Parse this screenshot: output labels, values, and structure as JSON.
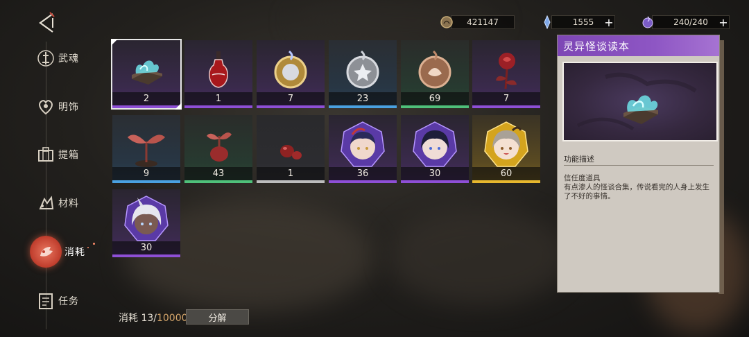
{
  "currency": {
    "coins": "421147",
    "crystals": "1555",
    "stamina": "240/240",
    "plus_label": "+"
  },
  "nav": [
    {
      "label": "武魂",
      "icon": "statue-icon",
      "active": false
    },
    {
      "label": "明饰",
      "icon": "heart-ornament-icon",
      "active": false
    },
    {
      "label": "提箱",
      "icon": "suitcase-icon",
      "active": false
    },
    {
      "label": "材料",
      "icon": "materials-icon",
      "active": false
    },
    {
      "label": "消耗",
      "icon": "consumable-icon",
      "active": true
    },
    {
      "label": "任务",
      "icon": "task-list-icon",
      "active": false
    }
  ],
  "items": [
    {
      "name": "灵异怪谈读本",
      "icon": "ghost-book-icon",
      "count": "2",
      "quality": "purple",
      "quality_color": "#8e4fd6",
      "selected": true
    },
    {
      "name": "red-potion",
      "icon": "red-potion-icon",
      "count": "1",
      "quality": "purple",
      "quality_color": "#8e4fd6"
    },
    {
      "name": "gold-medal",
      "icon": "gold-medal-icon",
      "count": "7",
      "quality": "purple",
      "quality_color": "#8e4fd6"
    },
    {
      "name": "silver-medal",
      "icon": "silver-medal-icon",
      "count": "23",
      "quality": "blue",
      "quality_color": "#4aa1e0"
    },
    {
      "name": "bronze-medal",
      "icon": "bronze-medal-icon",
      "count": "69",
      "quality": "green",
      "quality_color": "#4fc07a"
    },
    {
      "name": "rose",
      "icon": "rose-icon",
      "count": "7",
      "quality": "purple",
      "quality_color": "#8e4fd6"
    },
    {
      "name": "large-sprout",
      "icon": "sprout-large-icon",
      "count": "9",
      "quality": "blue",
      "quality_color": "#4aa1e0"
    },
    {
      "name": "small-sprout",
      "icon": "sprout-small-icon",
      "count": "43",
      "quality": "green",
      "quality_color": "#4fc07a"
    },
    {
      "name": "seeds",
      "icon": "seeds-icon",
      "count": "1",
      "quality": "gray",
      "quality_color": "#bdbdbd"
    },
    {
      "name": "character-shard-red-hair",
      "icon": "character-shard-icon",
      "count": "36",
      "quality": "purple",
      "quality_color": "#8e4fd6"
    },
    {
      "name": "character-shard-dark-hair",
      "icon": "character-shard-icon",
      "count": "30",
      "quality": "purple",
      "quality_color": "#8e4fd6"
    },
    {
      "name": "character-shard-blonde",
      "icon": "character-shard-gold-icon",
      "count": "60",
      "quality": "gold",
      "quality_color": "#e6b72e"
    },
    {
      "name": "character-shard-white-hair",
      "icon": "character-shard-icon",
      "count": "30",
      "quality": "purple",
      "quality_color": "#8e4fd6"
    }
  ],
  "footer": {
    "consume_prefix": "消耗 13/",
    "consume_max": "10000",
    "decompose_label": "分解"
  },
  "detail": {
    "title": "灵异怪谈读本",
    "section_label": "功能描述",
    "type_line": "信任度道具",
    "description": "有点渗人的怪谈合集，传说看完的人身上发生了不好的事情。",
    "accent_color": "#8e56c4"
  }
}
